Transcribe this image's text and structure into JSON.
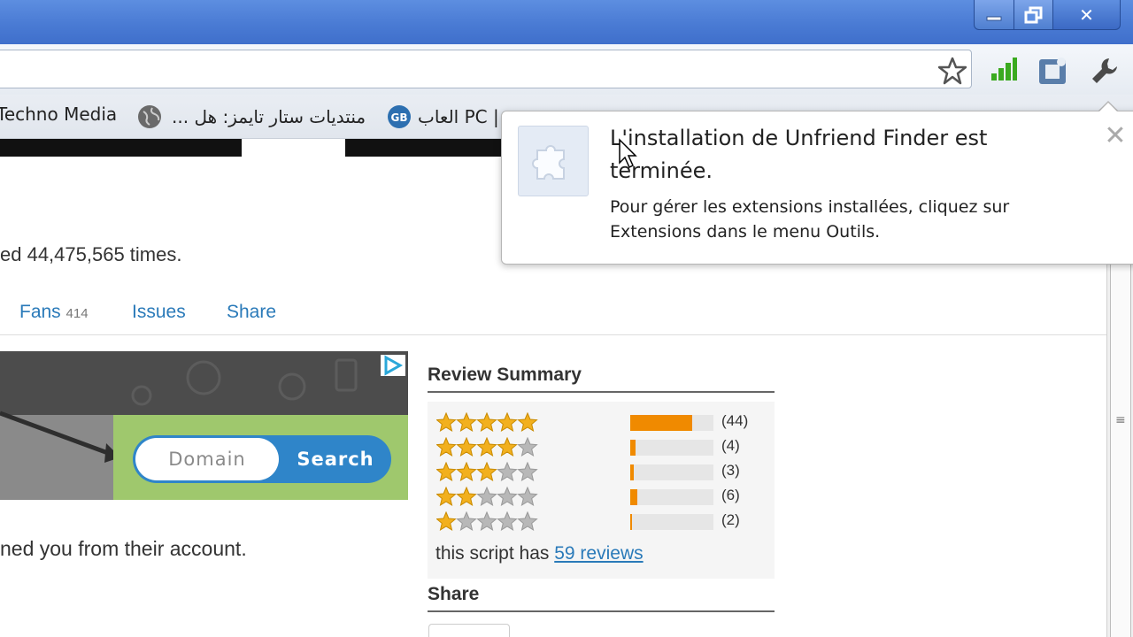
{
  "window": {
    "minimize_glyph": "—",
    "maximize_glyph": "⧉",
    "close_glyph": "✕"
  },
  "toolbar": {
    "icons": [
      "star-icon",
      "signal-icon",
      "extension-icon",
      "wrench-icon"
    ]
  },
  "bookmarks": [
    {
      "label": "Techno Media",
      "icon": "none"
    },
    {
      "label": "... منتديات ستار تايمز: هل",
      "icon": "globe-icon"
    },
    {
      "label": "العاب PC |",
      "icon": "gb-icon"
    }
  ],
  "page": {
    "installed_count_text": "ed 44,475,565 times.",
    "tabs": [
      {
        "label": "Fans",
        "count": "414"
      },
      {
        "label": "Issues"
      },
      {
        "label": "Share"
      }
    ],
    "ad": {
      "domain_placeholder": "Domain",
      "search_label": "Search"
    },
    "removed_text": "ned you from their account.",
    "review_summary": {
      "title": "Review Summary",
      "rows": [
        {
          "stars": 5,
          "count_text": "(44)",
          "count": 44,
          "fill": 0.74
        },
        {
          "stars": 4,
          "count_text": "(4)",
          "count": 4,
          "fill": 0.06
        },
        {
          "stars": 3,
          "count_text": "(3)",
          "count": 3,
          "fill": 0.04
        },
        {
          "stars": 2,
          "count_text": "(6)",
          "count": 6,
          "fill": 0.09
        },
        {
          "stars": 1,
          "count_text": "(2)",
          "count": 2,
          "fill": 0.02
        }
      ],
      "reviews_prefix": "this script has",
      "reviews_link": "59 reviews"
    },
    "share_title": "Share"
  },
  "bubble": {
    "title": "L'installation de Unfriend Finder est terminée.",
    "body": "Pour gérer les extensions installées, cliquez sur Extensions dans le menu Outils.",
    "close_glyph": "✕"
  },
  "colors": {
    "titlebar": "#4a7bd4",
    "link": "#2a7ab9",
    "rating_bar": "#f08a00",
    "star_gold": "#f2b01e",
    "star_gray": "#b8b8b8"
  }
}
